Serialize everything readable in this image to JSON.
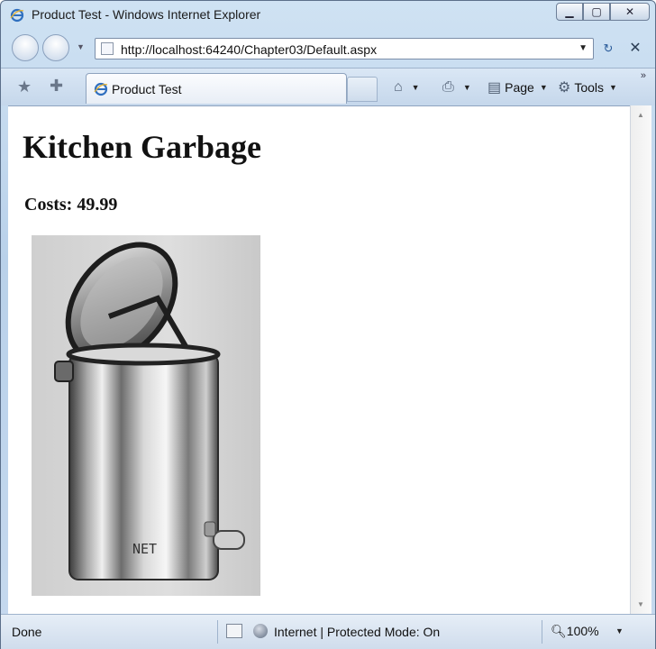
{
  "window": {
    "title": "Product Test - Windows Internet Explorer"
  },
  "toolbar": {
    "url": "http://localhost:64240/Chapter03/Default.aspx",
    "tab_title": "Product Test",
    "page_label": "Page",
    "tools_label": "Tools"
  },
  "content": {
    "heading": "Kitchen Garbage",
    "price_label": "Costs: 49.99",
    "image_text": "NET"
  },
  "status": {
    "text": "Done",
    "zone": "Internet | Protected Mode: On",
    "zoom": "100%"
  }
}
